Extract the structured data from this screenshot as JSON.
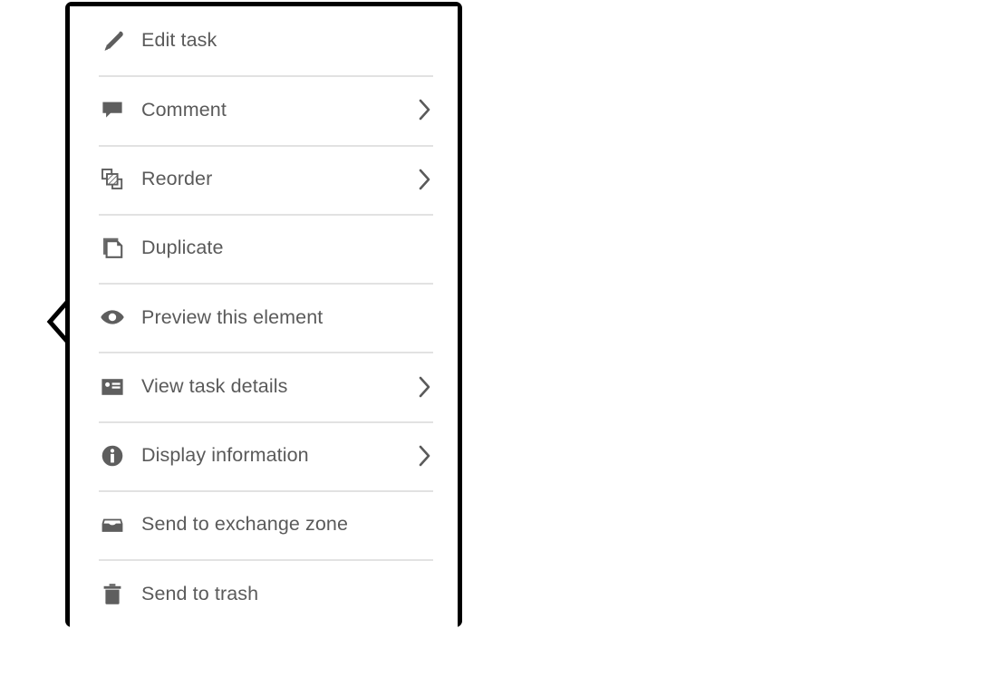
{
  "menu": {
    "name": "task-context-menu",
    "pointer_side": "left",
    "colors": {
      "border": "#000000",
      "background": "#ffffff",
      "text": "#5a5a5a",
      "icon": "#5e5e5e",
      "separator": "#e2e2e2"
    },
    "items": [
      {
        "label": "Edit task",
        "icon": "pencil-icon",
        "has_submenu": false,
        "submenu_glyph": ""
      },
      {
        "label": "Comment",
        "icon": "comment-icon",
        "has_submenu": true,
        "submenu_glyph": "›"
      },
      {
        "label": "Reorder",
        "icon": "reorder-icon",
        "has_submenu": true,
        "submenu_glyph": "›"
      },
      {
        "label": "Duplicate",
        "icon": "duplicate-icon",
        "has_submenu": false,
        "submenu_glyph": ""
      },
      {
        "label": "Preview this element",
        "icon": "eye-icon",
        "has_submenu": false,
        "submenu_glyph": ""
      },
      {
        "label": "View task details",
        "icon": "card-icon",
        "has_submenu": true,
        "submenu_glyph": "›"
      },
      {
        "label": "Display information",
        "icon": "info-icon",
        "has_submenu": true,
        "submenu_glyph": "›"
      },
      {
        "label": "Send to exchange zone",
        "icon": "inbox-icon",
        "has_submenu": false,
        "submenu_glyph": ""
      },
      {
        "label": "Send to trash",
        "icon": "trash-icon",
        "has_submenu": false,
        "submenu_glyph": ""
      }
    ]
  }
}
